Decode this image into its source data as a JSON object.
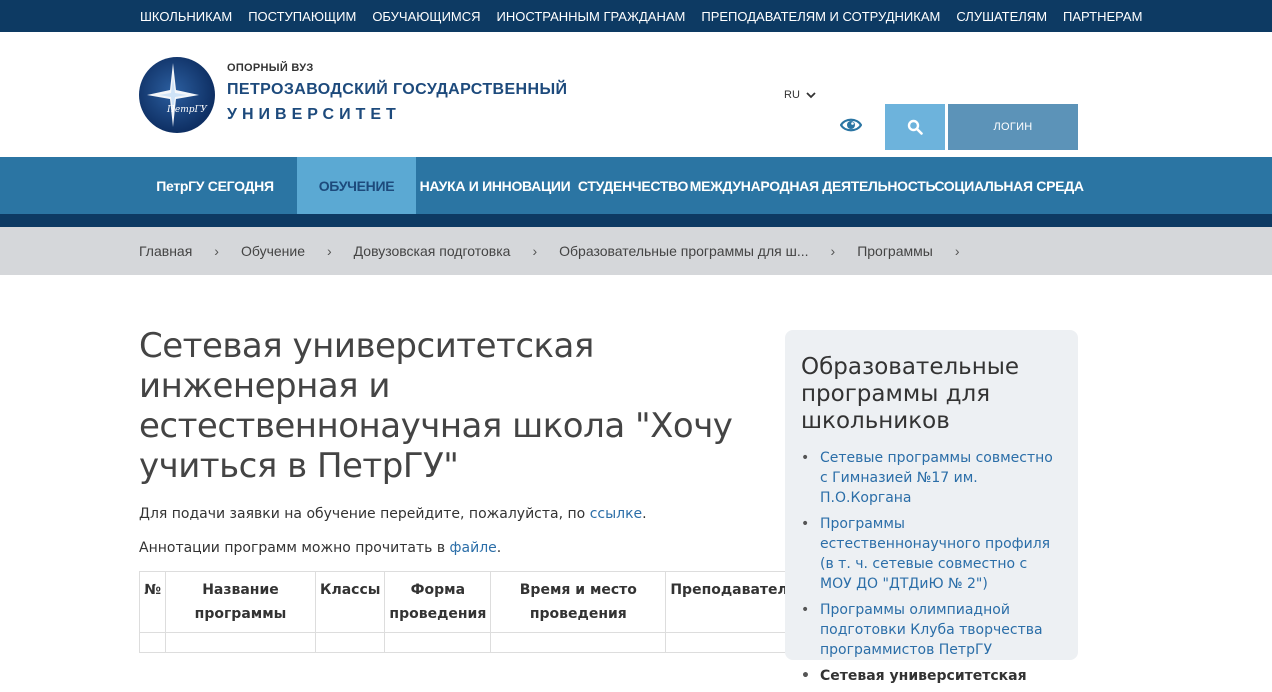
{
  "topnav": [
    "ШКОЛЬНИКАМ",
    "ПОСТУПАЮЩИМ",
    "ОБУЧАЮЩИМСЯ",
    "ИНОСТРАННЫМ ГРАЖДАНАМ",
    "ПРЕПОДАВАТЕЛЯМ И СОТРУДНИКАМ",
    "СЛУШАТЕЛЯМ",
    "ПАРТНЕРАМ"
  ],
  "logo": {
    "sub": "ОПОРНЫЙ ВУЗ",
    "line1": "ПЕТРОЗАВОДСКИЙ ГОСУДАРСТВЕННЫЙ",
    "line2": "УНИВЕРСИТЕТ",
    "emblem_text": "ПетрГУ"
  },
  "header": {
    "lang": "RU",
    "login": "ЛОГИН"
  },
  "mainnav": [
    "ПетрГУ СЕГОДНЯ",
    "ОБУЧЕНИЕ",
    "НАУКА И ИННОВАЦИИ",
    "СТУДЕНЧЕСТВО",
    "МЕЖДУНАРОДНАЯ ДЕЯТЕЛЬНОСТЬ",
    "СОЦИАЛЬНАЯ СРЕДА"
  ],
  "breadcrumb": [
    "Главная",
    "Обучение",
    "Довузовская подготовка",
    "Образовательные программы для ш...",
    "Программы"
  ],
  "content": {
    "title": "Сетевая университетская инженерная и естественнонаучная школа \"Хочу учиться в ПетрГУ\"",
    "p1_text": "Для подачи заявки на обучение перейдите, пожалуйста, по ",
    "p1_link": "ссылке",
    "p1_end": ".",
    "p2_text": "Аннотации программ можно прочитать в ",
    "p2_link": "файле",
    "p2_end": "."
  },
  "table": {
    "headers": [
      "№",
      "Название программы",
      "Классы",
      "Форма проведения",
      "Время и место проведения",
      "Преподаватель"
    ]
  },
  "sidebar": {
    "title": "Образовательные программы для школьников",
    "items": [
      "Сетевые программы совместно с Гимназией №17 им. П.О.Коргана",
      "Программы естественнонаучного профиля (в т. ч. сетевые совместно с МОУ ДО \"ДТДиЮ № 2\")",
      "Программы олимпиадной подготовки Клуба творчества программистов ПетрГУ",
      "Сетевая университетская"
    ]
  }
}
